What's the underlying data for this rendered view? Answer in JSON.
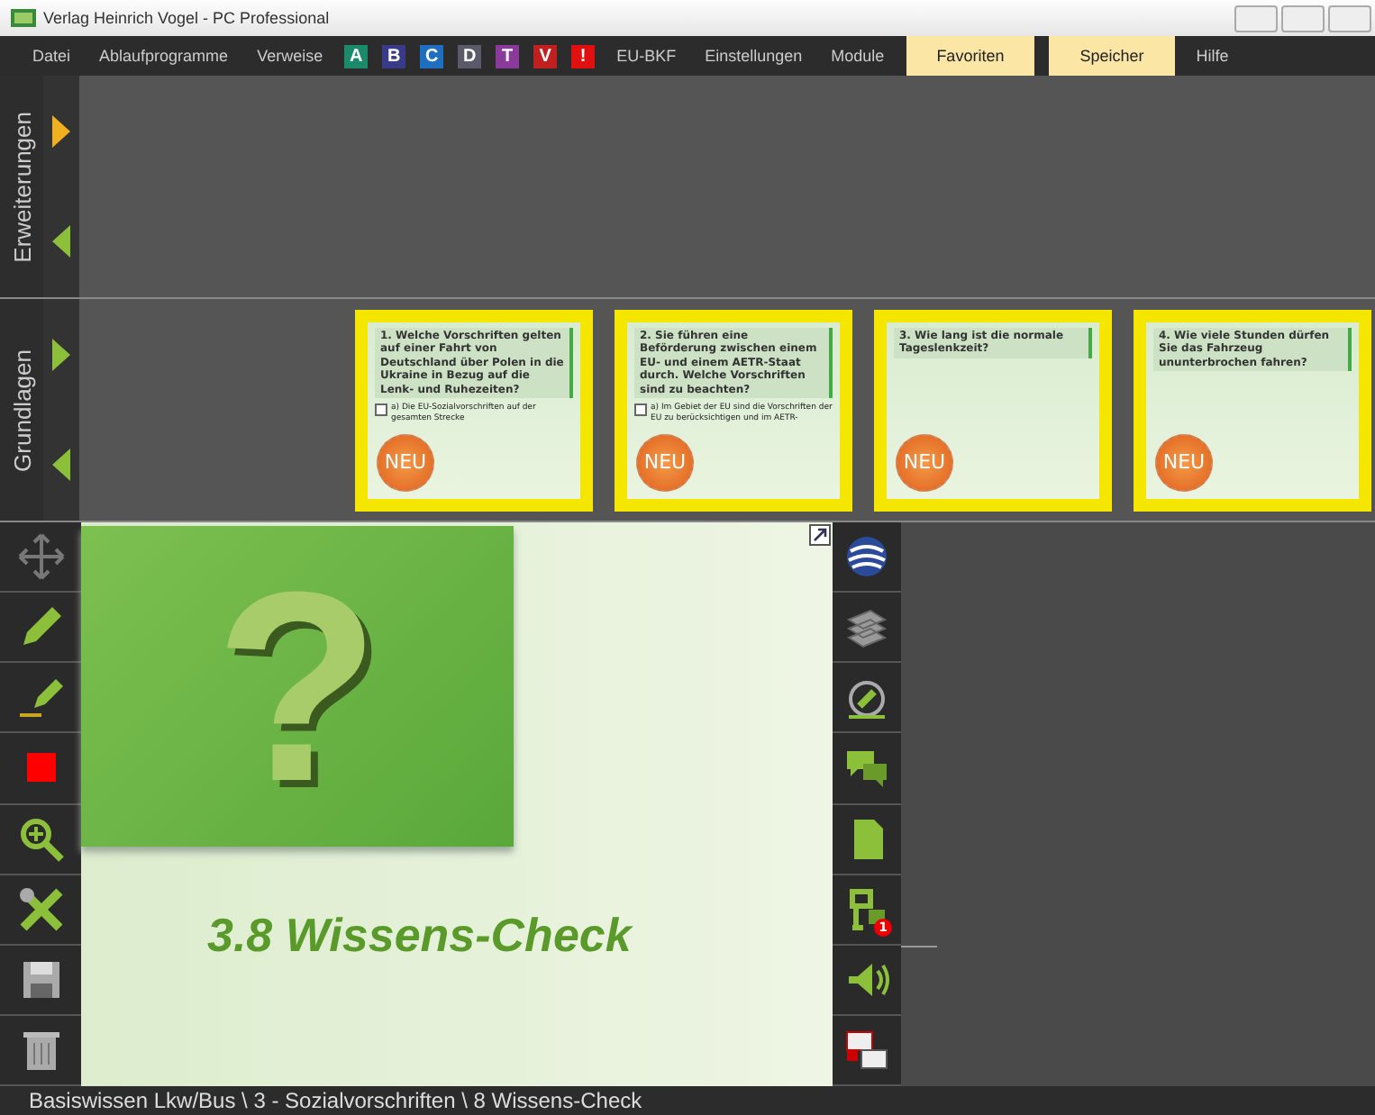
{
  "window": {
    "title": "Verlag Heinrich Vogel - PC Professional"
  },
  "menu": [
    {
      "kind": "item",
      "label": "Datei",
      "highlighted": false
    },
    {
      "kind": "item",
      "label": "Ablaufprogramme",
      "highlighted": false
    },
    {
      "kind": "item",
      "label": "Verweise",
      "highlighted": false
    },
    {
      "kind": "badge",
      "label": "A",
      "color": "#1a8a6a"
    },
    {
      "kind": "badge",
      "label": "B",
      "color": "#3a3a8a"
    },
    {
      "kind": "badge",
      "label": "C",
      "color": "#1e6fc0"
    },
    {
      "kind": "badge",
      "label": "D",
      "color": "#5a5a6a"
    },
    {
      "kind": "badge",
      "label": "T",
      "color": "#8a3a9a"
    },
    {
      "kind": "badge",
      "label": "V",
      "color": "#c02020"
    },
    {
      "kind": "badge",
      "label": "!",
      "color": "#e01010"
    },
    {
      "kind": "item",
      "label": "EU-BKF",
      "highlighted": false
    },
    {
      "kind": "item",
      "label": "Einstellungen",
      "highlighted": false
    },
    {
      "kind": "item",
      "label": "Module",
      "highlighted": false
    },
    {
      "kind": "item",
      "label": "Favoriten",
      "highlighted": true
    },
    {
      "kind": "item",
      "label": "Speicher",
      "highlighted": true
    },
    {
      "kind": "item",
      "label": "Hilfe",
      "highlighted": false
    }
  ],
  "panels": [
    {
      "label": "Erweiterungen",
      "expanded": true
    },
    {
      "label": "Grundlagen",
      "expanded": false,
      "cards": [
        {
          "question": "1. Welche Vorschriften gelten auf einer Fahrt von Deutschland über Polen in die Ukraine in Bezug auf die Lenk- und Ruhezeiten?",
          "answer": "a) Die EU-Sozialvorschriften auf der gesamten Strecke",
          "checked": false,
          "badge": "NEU"
        },
        {
          "question": "2. Sie führen eine Beförderung zwischen einem EU- und einem AETR-Staat durch. Welche Vorschriften sind zu beachten?",
          "answer": "a) Im Gebiet der EU sind die Vorschriften der EU zu berücksichtigen und im AETR-",
          "checked": false,
          "badge": "NEU"
        },
        {
          "question": "3. Wie lang ist die normale Tageslenkzeit?",
          "badge": "NEU"
        },
        {
          "question": "4. Wie viele Stunden dürfen Sie das Fahrzeug ununterbrochen fahren?",
          "badge": "NEU"
        }
      ]
    }
  ],
  "slide": {
    "symbol": "?",
    "title": "3.8 Wissens-Check"
  },
  "right_tools": [
    {
      "kind": "globe"
    },
    {
      "kind": "books"
    },
    {
      "kind": "compass"
    },
    {
      "kind": "chat"
    },
    {
      "kind": "page"
    },
    {
      "kind": "audio",
      "badge": "1"
    },
    {
      "kind": "sound"
    },
    {
      "kind": "windows"
    }
  ],
  "status_bar": "Basiswissen Lkw/Bus \\ 3 - Sozialvorschriften \\ 8 Wissens-Check"
}
